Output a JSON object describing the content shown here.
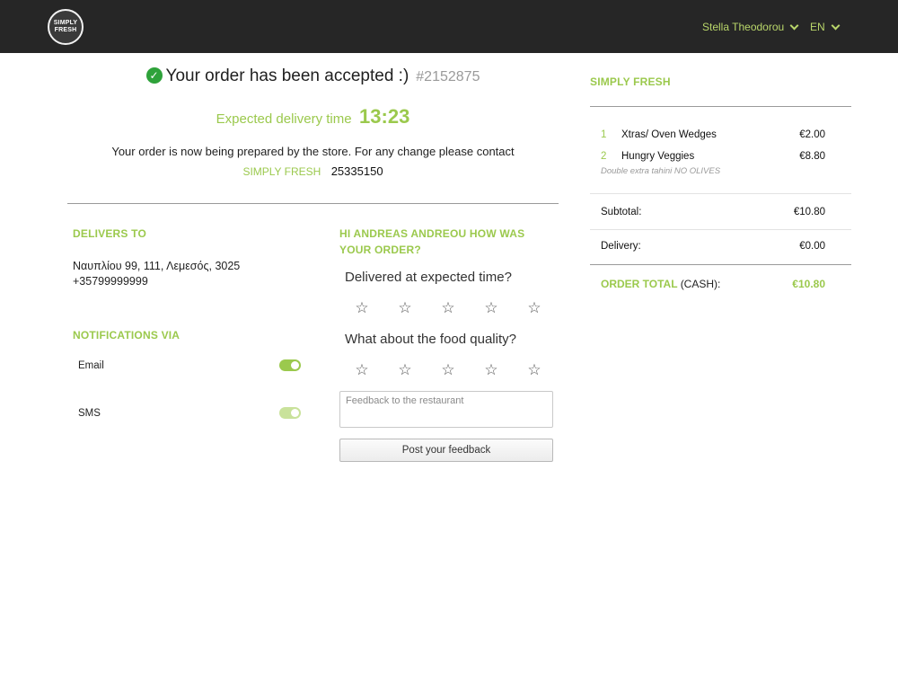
{
  "header": {
    "logo_line1": "SIMPLY",
    "logo_line2": "FRESH",
    "user_name": "Stella Theodorou",
    "language": "EN"
  },
  "order": {
    "status_text": "Your order has been accepted :)",
    "order_number": "#2152875",
    "expected_label": "Expected delivery time",
    "expected_time": "13:23",
    "preparing_text": "Your order is now being prepared by the store. For any change please contact",
    "store_name": "SIMPLY FRESH",
    "store_phone": "25335150"
  },
  "delivery": {
    "title": "DELIVERS TO",
    "address": "Ναυπλίου 99, 111, Λεμεσός, 3025",
    "phone": "+35799999999"
  },
  "notifications": {
    "title": "NOTIFICATIONS VIA",
    "items": [
      {
        "label": "Email",
        "enabled": true
      },
      {
        "label": "SMS",
        "enabled": true
      }
    ]
  },
  "feedback": {
    "title": "HI ANDREAS ANDREOU HOW WAS YOUR ORDER?",
    "question1": "Delivered at expected time?",
    "question2": "What about the food quality?",
    "star_glyph": "☆",
    "placeholder": "Feedback to the restaurant",
    "button_label": "Post your feedback"
  },
  "summary": {
    "store_name": "SIMPLY FRESH",
    "items": [
      {
        "qty": "1",
        "name": "Xtras/ Oven Wedges",
        "price": "€2.00"
      },
      {
        "qty": "2",
        "name": "Hungry Veggies",
        "price": "€8.80",
        "note": "Double extra tahini NO OLIVES"
      }
    ],
    "subtotal_label": "Subtotal:",
    "subtotal_value": "€10.80",
    "delivery_label": "Delivery:",
    "delivery_value": "€0.00",
    "total_label": "ORDER TOTAL",
    "payment_method": "(CASH)",
    "total_colon": ":",
    "total_value": "€10.80"
  },
  "colors": {
    "accent": "#9bc94d",
    "topbar": "#262626",
    "success": "#2ea23a"
  }
}
